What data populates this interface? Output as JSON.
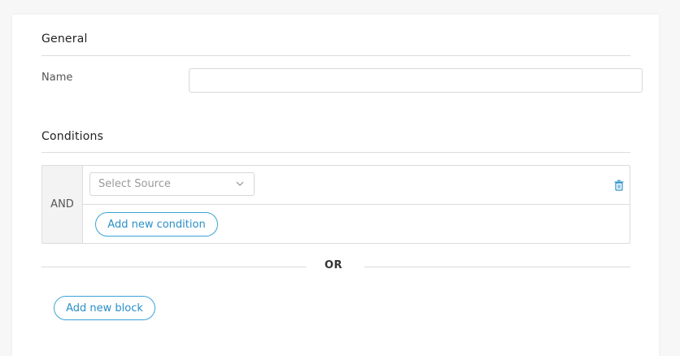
{
  "general": {
    "title": "General",
    "name_label": "Name",
    "name_value": "",
    "name_placeholder": ""
  },
  "conditions": {
    "title": "Conditions",
    "block": {
      "operator": "AND",
      "select_placeholder": "Select Source",
      "add_condition_label": "Add new condition"
    },
    "or_label": "OR",
    "add_block_label": "Add new block"
  },
  "icons": {
    "dropdown": "chevron-down-icon",
    "delete": "trash-icon"
  },
  "colors": {
    "accent": "#2a8fc7",
    "border": "#dcdcdc",
    "muted_bg": "#f3f3f3"
  }
}
